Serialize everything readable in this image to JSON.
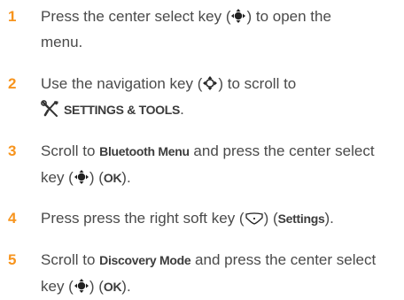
{
  "steps": [
    {
      "number": "1",
      "parts": {
        "a": "Press the center select key (",
        "b": ") to open the",
        "c": "menu."
      }
    },
    {
      "number": "2",
      "parts": {
        "a": "Use the navigation key (",
        "b": ") to scroll to",
        "c": "SETTINGS & TOOLS",
        "d": "."
      }
    },
    {
      "number": "3",
      "parts": {
        "a": "Scroll to ",
        "b": "Bluetooth Menu",
        "c": " and press the center select",
        "d": "key (",
        "e": ") (",
        "f": "OK",
        "g": ")."
      }
    },
    {
      "number": "4",
      "parts": {
        "a": "Press press the right soft key (",
        "b": ") (",
        "c": "Settings",
        "d": ")."
      }
    },
    {
      "number": "5",
      "parts": {
        "a": "Scroll to ",
        "b": "Discovery Mode",
        "c": " and press the center select",
        "d": "key (",
        "e": ") (",
        "f": "OK",
        "g": ")."
      }
    }
  ],
  "icons": {
    "center_select": "center-select-key-icon",
    "navigation": "navigation-key-icon",
    "right_soft": "right-soft-key-icon",
    "settings_tools": "settings-tools-icon"
  },
  "colors": {
    "step_number": "#f7941d",
    "body_text": "#4a4a4a"
  }
}
